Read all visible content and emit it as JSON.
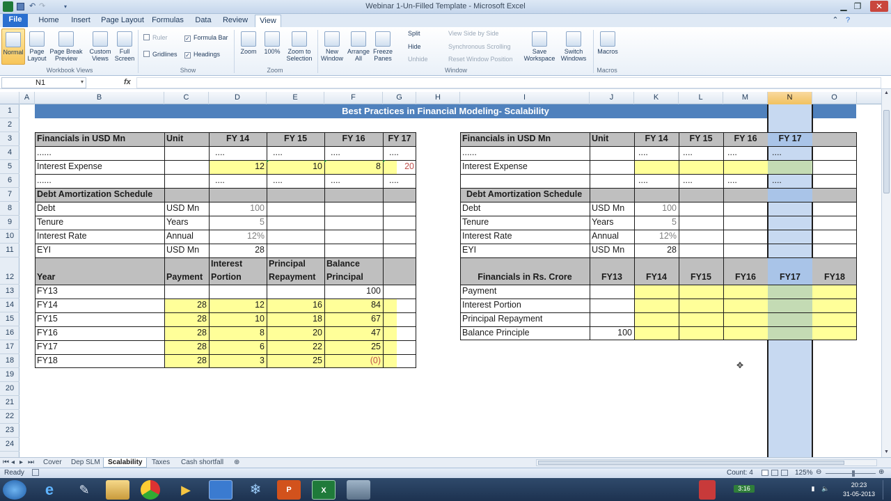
{
  "window": {
    "title": "Webinar 1-Un-Filled Template - Microsoft Excel"
  },
  "ribbon_tabs": [
    "File",
    "Home",
    "Insert",
    "Page Layout",
    "Formulas",
    "Data",
    "Review",
    "View"
  ],
  "active_tab": "View",
  "ribbon": {
    "workbook_views": {
      "normal": "Normal",
      "page_layout": "Page Layout",
      "page_break": "Page Break Preview",
      "custom_views": "Custom Views",
      "full_screen": "Full Screen",
      "group": "Workbook Views"
    },
    "show": {
      "ruler": "Ruler",
      "formula_bar": "Formula Bar",
      "gridlines": "Gridlines",
      "headings": "Headings",
      "group": "Show"
    },
    "zoom": {
      "zoom": "Zoom",
      "hundred": "100%",
      "zoom_selection": "Zoom to Selection",
      "group": "Zoom"
    },
    "window": {
      "new_window": "New Window",
      "arrange_all": "Arrange All",
      "freeze_panes": "Freeze Panes",
      "split": "Split",
      "hide": "Hide",
      "unhide": "Unhide",
      "view_side": "View Side by Side",
      "sync_scroll": "Synchronous Scrolling",
      "reset_pos": "Reset Window Position",
      "save_ws": "Save Workspace",
      "switch_windows": "Switch Windows",
      "group": "Window"
    },
    "macros": {
      "macros": "Macros",
      "group": "Macros"
    }
  },
  "formula_bar": {
    "name_box": "N1",
    "fx": "fx",
    "formula": ""
  },
  "columns": [
    "A",
    "B",
    "C",
    "D",
    "E",
    "F",
    "G",
    "H",
    "I",
    "J",
    "K",
    "L",
    "M",
    "N",
    "O"
  ],
  "selected_column": "N",
  "rows": [
    "1",
    "2",
    "3",
    "4",
    "5",
    "6",
    "7",
    "8",
    "9",
    "10",
    "11",
    "12",
    "13",
    "14",
    "15",
    "16",
    "17",
    "18",
    "19",
    "20",
    "21",
    "22",
    "23",
    "24"
  ],
  "sheet": {
    "title": "Best Practices in Financial Modeling- Scalability",
    "left": {
      "head": [
        "Financials in USD Mn",
        "Unit",
        "FY 14",
        "FY 15",
        "FY 16",
        "FY 17"
      ],
      "dots": [
        "......",
        "....",
        "....",
        "....",
        "...."
      ],
      "interest_expense": {
        "label": "Interest Expense",
        "values": [
          "12",
          "10",
          "8",
          "20"
        ]
      },
      "dots2": [
        "......",
        "....",
        "....",
        "....",
        "...."
      ],
      "das": "Debt Amortization Schedule",
      "debt": {
        "label": "Debt",
        "unit": "USD Mn",
        "value": "100"
      },
      "tenure": {
        "label": "Tenure",
        "unit": "Years",
        "value": "5"
      },
      "rate": {
        "label": "Interest Rate",
        "unit": "Annual",
        "value": "12%"
      },
      "eyi": {
        "label": "EYI",
        "unit": "USD Mn",
        "value": "28"
      },
      "sched_head": [
        "Year",
        "Payment",
        "Interest Portion",
        "Principal Repayment",
        "Balance Principal"
      ],
      "sched": [
        [
          "FY13",
          "",
          "",
          "",
          "100"
        ],
        [
          "FY14",
          "28",
          "12",
          "16",
          "84"
        ],
        [
          "FY15",
          "28",
          "10",
          "18",
          "67"
        ],
        [
          "FY16",
          "28",
          "8",
          "20",
          "47"
        ],
        [
          "FY17",
          "28",
          "6",
          "22",
          "25"
        ],
        [
          "FY18",
          "28",
          "3",
          "25",
          "(0)"
        ]
      ]
    },
    "right": {
      "head": [
        "Financials in USD Mn",
        "Unit",
        "FY 14",
        "FY 15",
        "FY 16",
        "FY 17"
      ],
      "dots": [
        "......",
        "....",
        "....",
        "....",
        "...."
      ],
      "interest_expense": "Interest Expense",
      "dots2": [
        "....",
        "....",
        "....",
        "...."
      ],
      "das": "Debt Amortization Schedule",
      "debt": {
        "label": "Debt",
        "unit": "USD Mn",
        "value": "100"
      },
      "tenure": {
        "label": "Tenure",
        "unit": "Years",
        "value": "5"
      },
      "rate": {
        "label": "Interest Rate",
        "unit": "Annual",
        "value": "12%"
      },
      "eyi": {
        "label": "EYI",
        "unit": "USD Mn",
        "value": "28"
      },
      "sched_head": [
        "Financials in Rs. Crore",
        "FY13",
        "FY14",
        "FY15",
        "FY16",
        "FY17",
        "FY18"
      ],
      "sched_rows": [
        "Payment",
        "Interest Portion",
        "Principal Repayment",
        "Balance Principle"
      ],
      "balance_fy13": "100"
    }
  },
  "sheet_tabs": [
    "Cover",
    "Dep SLM",
    "Scalability",
    "Taxes",
    "Cash shortfall"
  ],
  "active_sheet": "Scalability",
  "status": {
    "mode": "Ready",
    "count": "Count: 4",
    "zoom": "125%"
  },
  "taskbar": {
    "time": "20:23",
    "date": "31-05-2013",
    "badge": "3:16"
  }
}
